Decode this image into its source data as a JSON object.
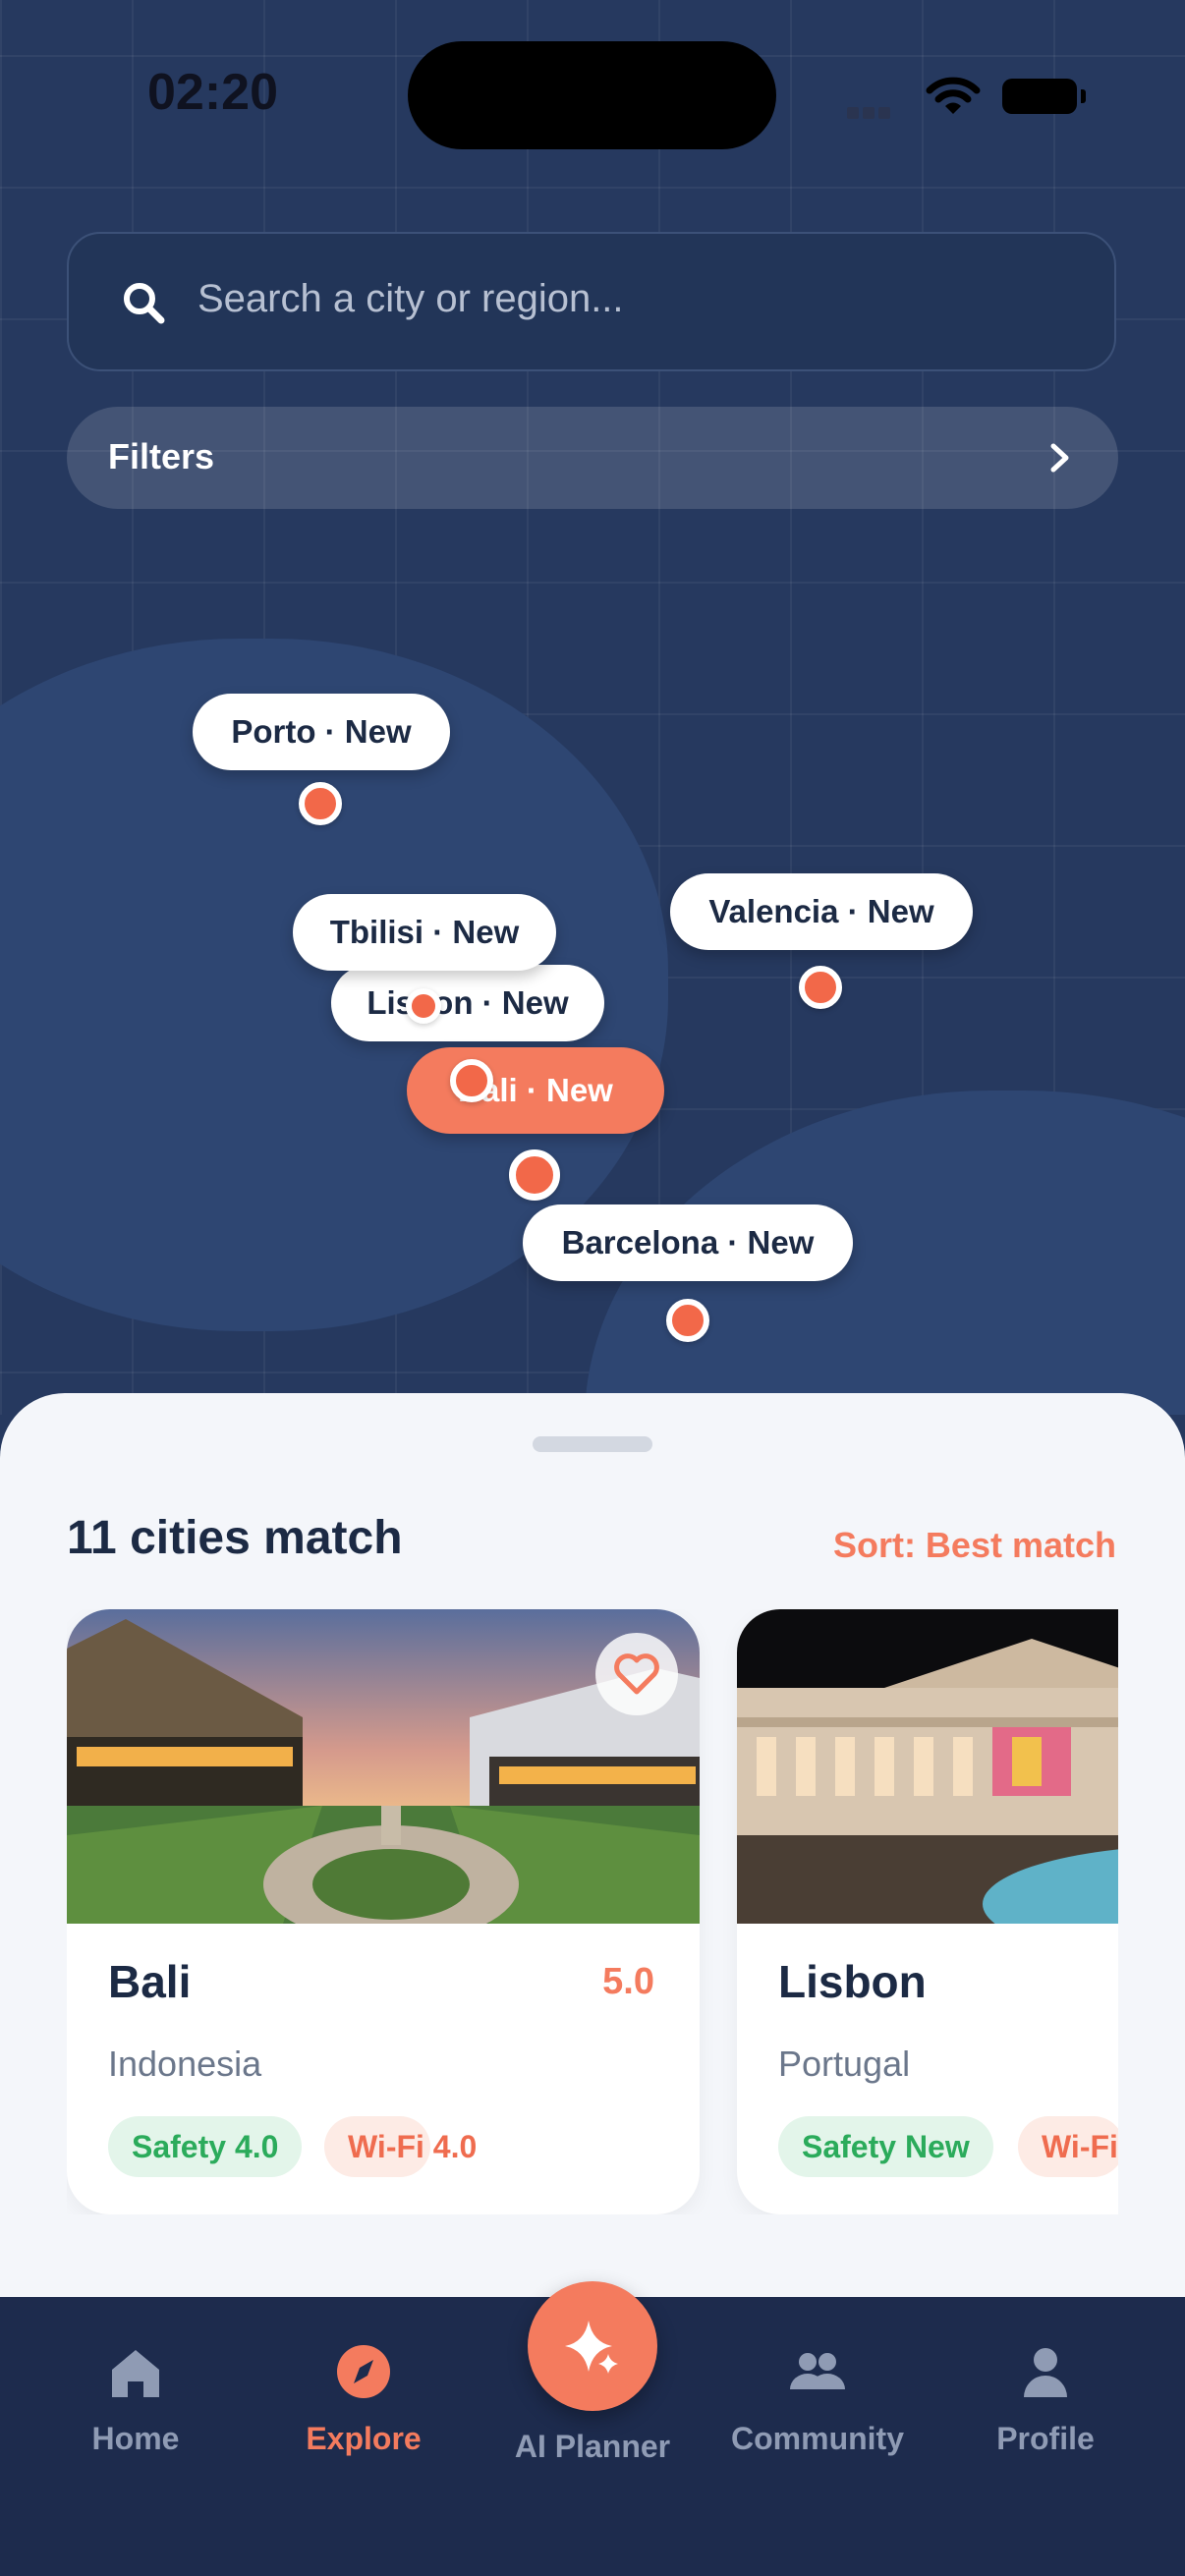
{
  "status_bar": {
    "time": "02:20"
  },
  "search": {
    "placeholder": "Search a city or region..."
  },
  "filters": {
    "label": "Filters"
  },
  "map": {
    "pins": [
      {
        "label": "Porto · New",
        "active": false
      },
      {
        "label": "Valencia · New",
        "active": false
      },
      {
        "label": "Tbilisi · New",
        "active": false
      },
      {
        "label": "Lisbon · New",
        "active": false
      },
      {
        "label": "Bali · New",
        "active": true
      },
      {
        "label": "Barcelona · New",
        "active": false
      }
    ]
  },
  "results": {
    "count_label": "11 cities match",
    "sort_label": "Sort: Best match",
    "cards": [
      {
        "name": "Bali",
        "country": "Indonesia",
        "score": "5.0",
        "tags": [
          "Safety 4.0",
          "Wi-Fi 4.0"
        ]
      },
      {
        "name": "Lisbon",
        "country": "Portugal",
        "score": "",
        "tags": [
          "Safety New",
          "Wi-Fi"
        ]
      }
    ]
  },
  "nav": {
    "items": [
      {
        "label": "Home",
        "icon": "home-icon"
      },
      {
        "label": "Explore",
        "icon": "compass-icon",
        "active": true
      },
      {
        "label": "AI Planner",
        "icon": "sparkle-icon"
      },
      {
        "label": "Community",
        "icon": "people-icon"
      },
      {
        "label": "Profile",
        "icon": "person-icon"
      }
    ]
  },
  "colors": {
    "accent": "#f47b5e",
    "map_bg": "#26395f",
    "nav_bg": "#1d2b4d",
    "sheet_bg": "#f4f6fa"
  }
}
